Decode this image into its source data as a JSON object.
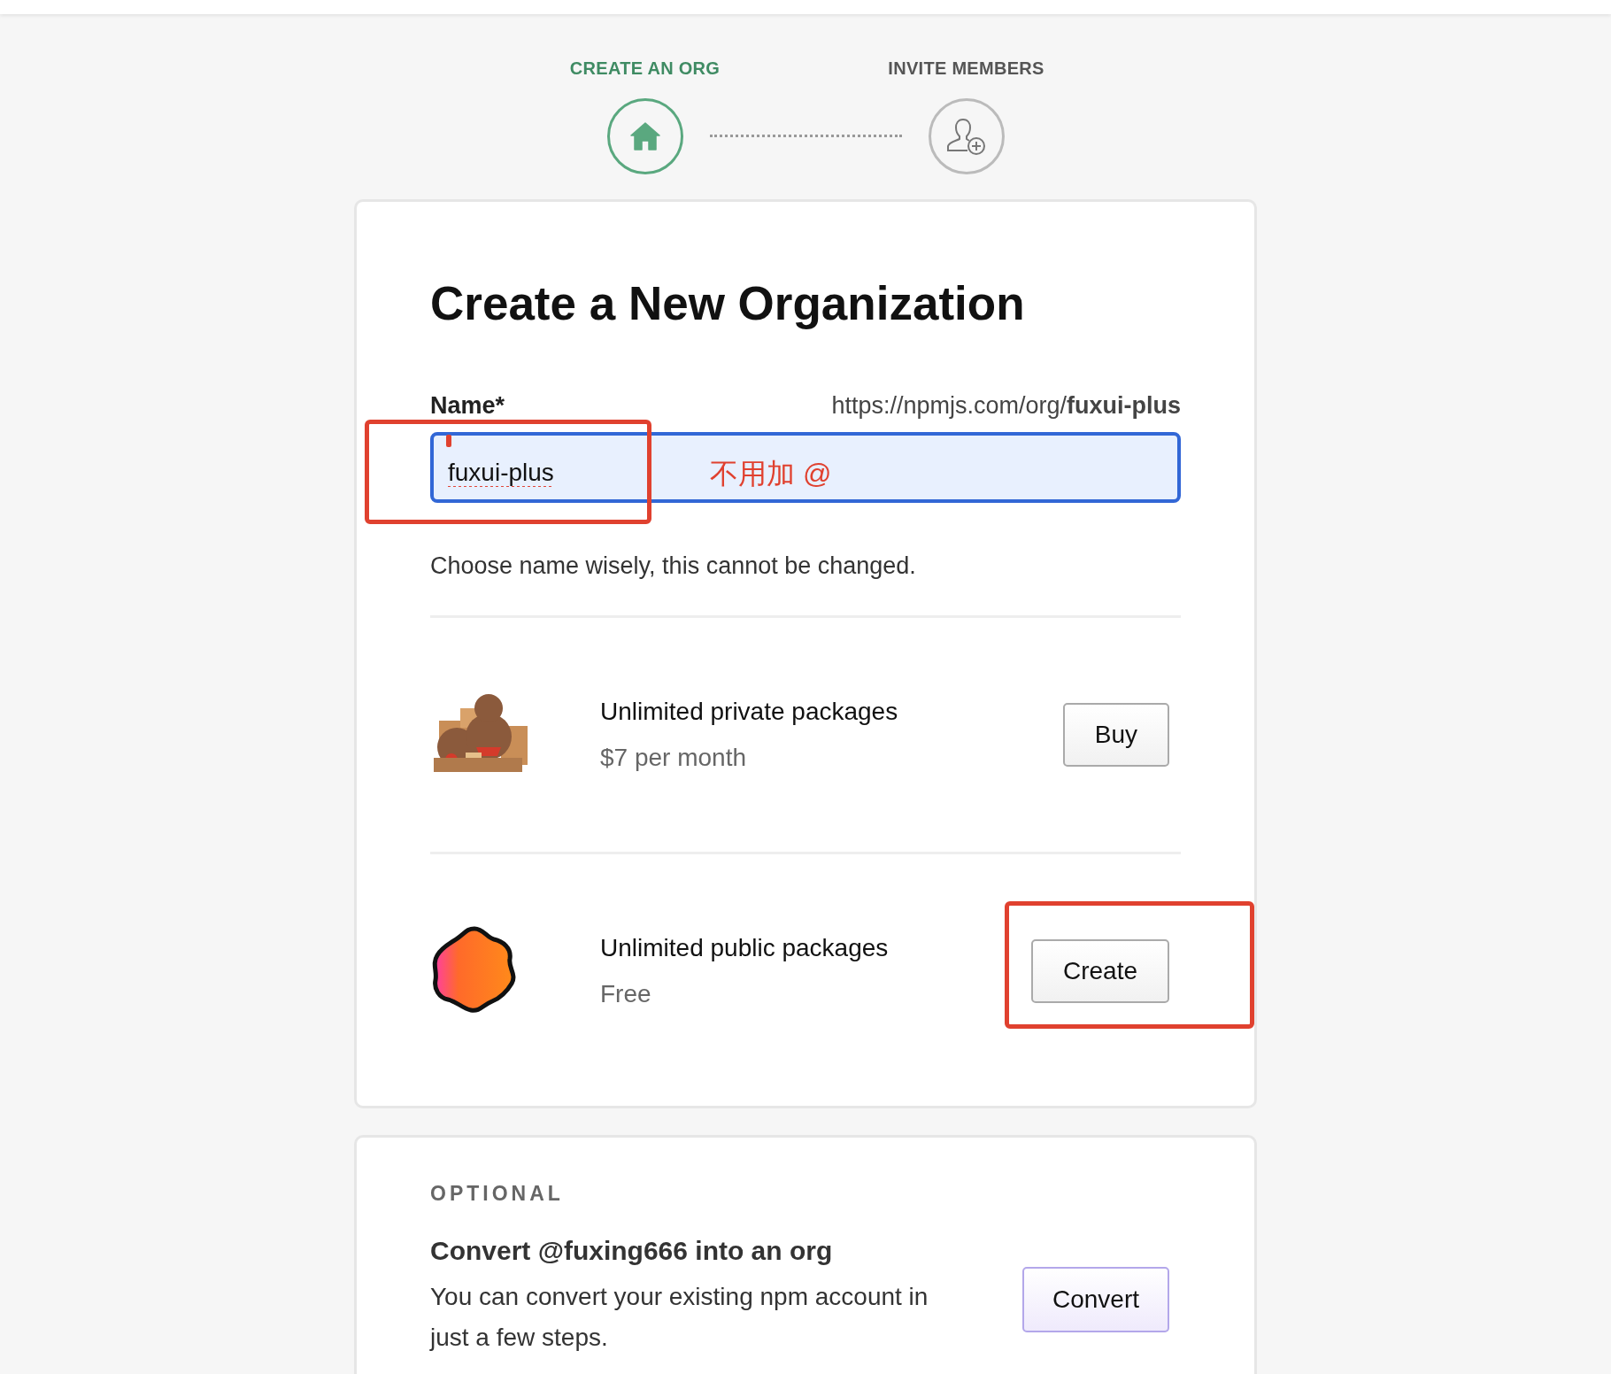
{
  "steps": [
    {
      "label": "CREATE AN ORG",
      "selected": true,
      "kind": "home"
    },
    {
      "label": "INVITE MEMBERS",
      "selected": false,
      "kind": "add-user"
    }
  ],
  "form": {
    "title": "Create a New Organization",
    "name_label": "Name*",
    "url": "https://npmjs.com/org/**fuxui-plus**",
    "name_value": "fuxui-plus",
    "focused": true,
    "hint": "Choose name wisely, this cannot be changed."
  },
  "plans": [
    {
      "kind": "bears",
      "title": "Unlimited private packages",
      "price": "$7 per month",
      "button": "Buy",
      "highlighted": false
    },
    {
      "kind": "badge",
      "title": "Unlimited public packages",
      "price": "Free",
      "button": "Create",
      "highlighted": true
    }
  ],
  "optional": {
    "eyebrow": "OPTIONAL",
    "title": "Convert @fuxing666 into an org",
    "description": "You can convert your existing npm account in just a few steps.",
    "button": "Convert"
  },
  "annotations": {
    "note": "不用加 @",
    "highlight_name": true
  }
}
